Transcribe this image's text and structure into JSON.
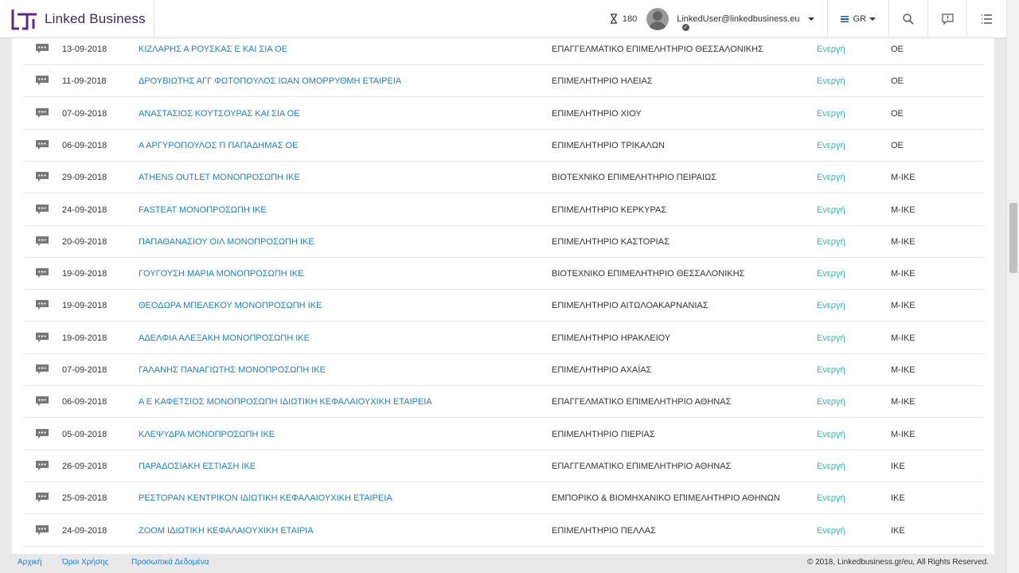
{
  "header": {
    "brand": "Linked Business",
    "credits": "180",
    "user_email": "LinkedUser@linkedbusiness.eu",
    "language": "GR"
  },
  "rows": [
    {
      "date": "13-09-2018",
      "name": "ΚΙΖΛΑΡΗΣ Α ΡΟΥΣΚΑΣ Ε ΚΑΙ ΣΙΑ ΟΕ",
      "chamber": "ΕΠΑΓΓΕΛΜΑΤΙΚΟ ΕΠΙΜΕΛΗΤΗΡΙΟ ΘΕΣΣΑΛΟΝΙΚΗΣ",
      "status": "Ενεργή",
      "type": "ΟΕ"
    },
    {
      "date": "11-09-2018",
      "name": "ΔΡΟΥΒΙΩΤΗΣ ΑΓΓ ΦΩΤΟΠΟΥΛΟΣ ΙΩΑΝ ΟΜΟΡΡΥΘΜΗ ΕΤΑΙΡΕΙΑ",
      "chamber": "ΕΠΙΜΕΛΗΤΗΡΙΟ ΗΛΕΙΑΣ",
      "status": "Ενεργή",
      "type": "ΟΕ"
    },
    {
      "date": "07-09-2018",
      "name": "ΑΝΑΣΤΑΣΙΟΣ ΚΟΥΤΣΟΥΡΑΣ ΚΑΙ ΣΙΑ ΟΕ",
      "chamber": "ΕΠΙΜΕΛΗΤΗΡΙΟ ΧΙΟΥ",
      "status": "Ενεργή",
      "type": "ΟΕ"
    },
    {
      "date": "06-09-2018",
      "name": "Α ΑΡΓΥΡΟΠΟΥΛΟΣ Π ΠΑΠΑΔΗΜΑΣ ΟΕ",
      "chamber": "ΕΠΙΜΕΛΗΤΗΡΙΟ ΤΡΙΚΑΛΩΝ",
      "status": "Ενεργή",
      "type": "ΟΕ"
    },
    {
      "date": "29-09-2018",
      "name": "ATHENS OUTLET ΜΟΝΟΠΡΟΣΩΠΗ ΙΚΕ",
      "chamber": "ΒΙΟΤΕΧΝΙΚΟ ΕΠΙΜΕΛΗΤΗΡΙΟ ΠΕΙΡΑΙΩΣ",
      "status": "Ενεργή",
      "type": "Μ-ΙΚΕ"
    },
    {
      "date": "24-09-2018",
      "name": "FASTEAT ΜΟΝΟΠΡΟΣΩΠΗ ΙΚΕ",
      "chamber": "ΕΠΙΜΕΛΗΤΗΡΙΟ ΚΕΡΚΥΡΑΣ",
      "status": "Ενεργή",
      "type": "Μ-ΙΚΕ"
    },
    {
      "date": "20-09-2018",
      "name": "ΠΑΠΑΘΑΝΑΣΙΟΥ ΟΙΛ ΜΟΝΟΠΡΟΣΩΠΗ ΙΚΕ",
      "chamber": "ΕΠΙΜΕΛΗΤΗΡΙΟ ΚΑΣΤΟΡΙΑΣ",
      "status": "Ενεργή",
      "type": "Μ-ΙΚΕ"
    },
    {
      "date": "19-09-2018",
      "name": "ΓΟΥΓΟΥΣΗ ΜΑΡΙΑ ΜΟΝΟΠΡΟΣΩΠΗ ΙΚΕ",
      "chamber": "ΒΙΟΤΕΧΝΙΚΟ ΕΠΙΜΕΛΗΤΗΡΙΟ ΘΕΣΣΑΛΟΝΙΚΗΣ",
      "status": "Ενεργή",
      "type": "Μ-ΙΚΕ"
    },
    {
      "date": "19-09-2018",
      "name": "ΘΕΟΔΩΡΑ ΜΠΕΛΕΚΟΥ ΜΟΝΟΠΡΟΣΩΠΗ ΙΚΕ",
      "chamber": "ΕΠΙΜΕΛΗΤΗΡΙΟ ΑΙΤΩΛΟΑΚΑΡΝΑΝΙΑΣ",
      "status": "Ενεργή",
      "type": "Μ-ΙΚΕ"
    },
    {
      "date": "19-09-2018",
      "name": "ΑΔΕΛΦΙΑ ΑΛΕΞΑΚΗ ΜΟΝΟΠΡΟΣΩΠΗ ΙΚΕ",
      "chamber": "ΕΠΙΜΕΛΗΤΗΡΙΟ ΗΡΑΚΛΕΙΟΥ",
      "status": "Ενεργή",
      "type": "Μ-ΙΚΕ"
    },
    {
      "date": "07-09-2018",
      "name": "ΓΑΛΑΝΗΣ ΠΑΝΑΓΙΩΤΗΣ ΜΟΝΟΠΡΟΣΩΠΗ ΙΚΕ",
      "chamber": "ΕΠΙΜΕΛΗΤΗΡΙΟ ΑΧΑΪΑΣ",
      "status": "Ενεργή",
      "type": "Μ-ΙΚΕ"
    },
    {
      "date": "06-09-2018",
      "name": "Α Ε ΚΑΦΕΤΣΙΟΣ ΜΟΝΟΠΡΟΣΩΠΗ ΙΔΙΩΤΙΚΗ ΚΕΦΑΛΑΙΟΥΧΙΚΗ ΕΤΑΙΡΕΙΑ",
      "chamber": "ΕΠΑΓΓΕΛΜΑΤΙΚΟ ΕΠΙΜΕΛΗΤΗΡΙΟ ΑΘΗΝΑΣ",
      "status": "Ενεργή",
      "type": "Μ-ΙΚΕ"
    },
    {
      "date": "05-09-2018",
      "name": "ΚΛΕΨΥΔΡΑ ΜΟΝΟΠΡΟΣΩΠΗ ΙΚΕ",
      "chamber": "ΕΠΙΜΕΛΗΤΗΡΙΟ ΠΙΕΡΙΑΣ",
      "status": "Ενεργή",
      "type": "Μ-ΙΚΕ"
    },
    {
      "date": "26-09-2018",
      "name": "ΠΑΡΑΔΟΣΙΑΚΗ ΕΣΤΙΑΣΗ ΙΚΕ",
      "chamber": "ΕΠΑΓΓΕΛΜΑΤΙΚΟ ΕΠΙΜΕΛΗΤΗΡΙΟ ΑΘΗΝΑΣ",
      "status": "Ενεργή",
      "type": "ΙΚΕ"
    },
    {
      "date": "25-09-2018",
      "name": "ΡΕΣΤΟΡΑΝ ΚΕΝΤΡΙΚΟΝ ΙΔΙΩΤΙΚΗ ΚΕΦΑΛΑΙΟΥΧΙΚΗ ΕΤΑΙΡΕΙΑ",
      "chamber": "ΕΜΠΟΡΙΚΟ & ΒΙΟΜΗΧΑΝΙΚΟ ΕΠΙΜΕΛΗΤΗΡΙΟ ΑΘΗΝΩΝ",
      "status": "Ενεργή",
      "type": "ΙΚΕ"
    },
    {
      "date": "24-09-2018",
      "name": "ZOOM ΙΔΙΩΤΙΚΗ ΚΕΦΑΛΑΙΟΥΧΙΚΗ ΕΤΑΙΡΙΑ",
      "chamber": "ΕΠΙΜΕΛΗΤΗΡΙΟ ΠΕΛΛΑΣ",
      "status": "Ενεργή",
      "type": "ΙΚΕ"
    }
  ],
  "footer": {
    "home": "Αρχική",
    "terms": "Όροι Χρήσης",
    "privacy": "Προσωπικά Δεδομένα",
    "copyright": "© 2018, Linkedbusiness.gr/eu, All Rights Reserved."
  },
  "colors": {
    "link": "#1f7fc9",
    "status_active": "#3db5a3",
    "brand": "#3b2a5e"
  }
}
